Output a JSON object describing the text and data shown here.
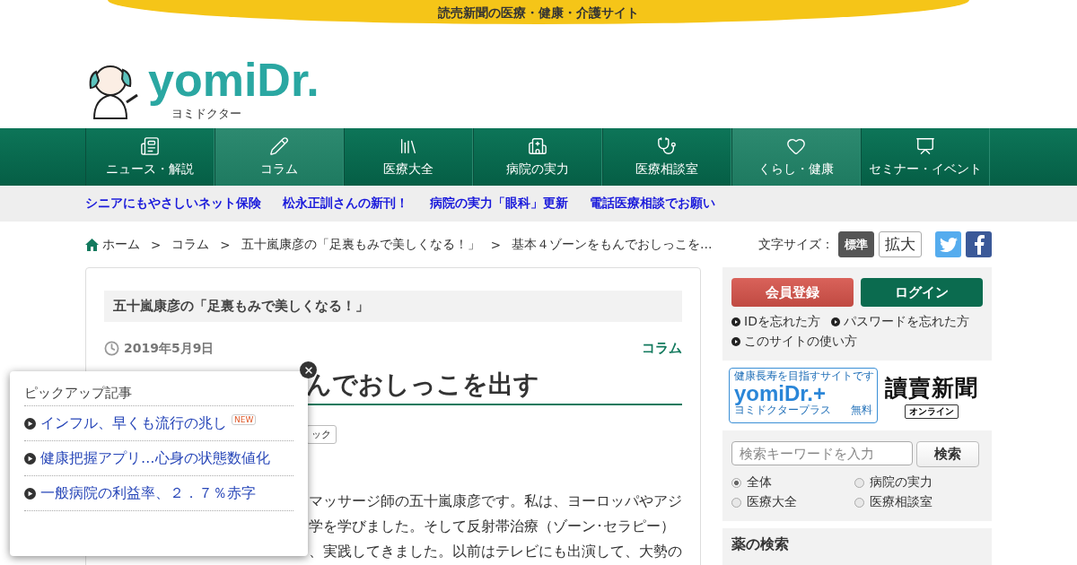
{
  "banner": "読売新聞の医療・健康・介護サイト",
  "logo": {
    "name": "yomiDr.",
    "reading": "ヨミドクター"
  },
  "nav": [
    {
      "label": "ニュース・解説",
      "selected": false
    },
    {
      "label": "コラム",
      "selected": true
    },
    {
      "label": "医療大全",
      "selected": false
    },
    {
      "label": "病院の実力",
      "selected": false
    },
    {
      "label": "医療相談室",
      "selected": false
    },
    {
      "label": "くらし・健康",
      "selected": true
    },
    {
      "label": "セミナー・イベント",
      "selected": false
    }
  ],
  "promo_links": [
    "シニアにもやさしいネット保険",
    "松永正訓さんの新刊！",
    "病院の実力「眼科」更新",
    "電話医療相談でお願い"
  ],
  "breadcrumb": [
    {
      "label": "ホーム"
    },
    {
      "separator": ">",
      "label": "コラム"
    },
    {
      "separator": ">",
      "label": "五十嵐康彦の「足裏もみで美しくなる！」"
    },
    {
      "separator": ">",
      "label": "基本４ゾーンをもんでおしっこを…"
    }
  ],
  "font_size": {
    "label": "文字サイズ：",
    "options": [
      {
        "label": "標準",
        "selected": true
      },
      {
        "label": "拡大",
        "selected": false
      }
    ]
  },
  "article": {
    "series": "五十嵐康彦の「足裏もみで美しくなる！」",
    "date": "2019年5月9日",
    "category": "コラム",
    "title": "んでおしっこを出す",
    "tag": "ック",
    "body": [
      "マッサージ師の五十嵐康彦です。私は、ヨーロッパやアジ",
      "学を学びました。そして反射帯治療（ゾーン･セラピー）",
      "、実践してきました。以前はテレビにも出演して、大勢の"
    ]
  },
  "popup": {
    "title": "ピックアップ記事",
    "items": [
      {
        "text": "インフル、早くも流行の兆し",
        "badge": "NEW"
      },
      {
        "text": "健康把握アプリ…心身の状態数値化"
      },
      {
        "text": "一般病院の利益率、２．７％赤字"
      }
    ]
  },
  "account": {
    "register": "会員登録",
    "login": "ログイン",
    "links": [
      "IDを忘れた方",
      "パスワードを忘れた方",
      "このサイトの使い方"
    ]
  },
  "partners": {
    "plus_tagline": "健康長寿を目指すサイトです",
    "plus_name": "yomiDr.+",
    "plus_reading": "ヨミドクタープラス",
    "plus_free": "無料",
    "yomiuri": "讀賣新聞",
    "yomiuri_sub": "オンライン"
  },
  "search": {
    "placeholder": "検索キーワードを入力",
    "button": "検索",
    "scopes": [
      {
        "label": "全体",
        "selected": true
      },
      {
        "label": "病院の実力",
        "selected": false
      },
      {
        "label": "医療大全",
        "selected": false
      },
      {
        "label": "医療相談室",
        "selected": false
      }
    ]
  },
  "drug_search": {
    "title": "薬の検索"
  }
}
